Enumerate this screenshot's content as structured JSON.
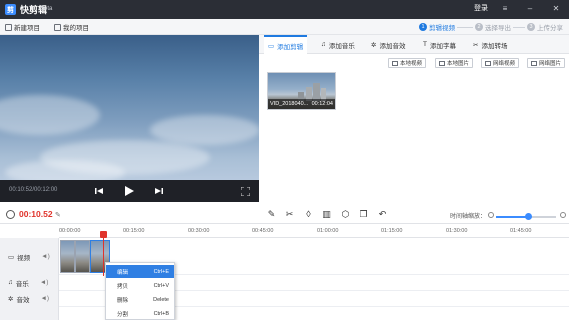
{
  "app": {
    "title": "快剪辑",
    "badge": "Beta"
  },
  "titlebar": {
    "login": "登录"
  },
  "toolbar": {
    "new_project": "新建项目",
    "my_projects": "我的项目"
  },
  "steps": [
    {
      "num": "1",
      "label": "剪辑视频"
    },
    {
      "num": "2",
      "label": "选择导出"
    },
    {
      "num": "3",
      "label": "上传分享"
    }
  ],
  "player": {
    "timecode": "00:10:52/00:12:00"
  },
  "right_tabs": [
    "添加剪辑",
    "添加音乐",
    "添加音效",
    "添加字幕",
    "添加转场"
  ],
  "source_buttons": [
    "本地视频",
    "本地图片",
    "网络视频",
    "网络图片"
  ],
  "media": {
    "name": "VID_2018040...",
    "duration": "00:12:04"
  },
  "edit": {
    "current_time": "00:10.52",
    "zoom_label": "时间轴缩放：",
    "zoom_level": 0.5
  },
  "ruler": [
    "00:00:00",
    "00:15:00",
    "00:30:00",
    "00:45:00",
    "01:00:00",
    "01:15:00",
    "01:30:00",
    "01:45:00"
  ],
  "tracks": [
    {
      "label": "视频"
    },
    {
      "label": "音乐"
    },
    {
      "label": "音效"
    }
  ],
  "context_menu": [
    {
      "label": "编辑",
      "shortcut": "Ctrl+E"
    },
    {
      "label": "拷贝",
      "shortcut": "Ctrl+V"
    },
    {
      "label": "删除",
      "shortcut": "Delete"
    },
    {
      "label": "分割",
      "shortcut": "Ctrl+B"
    }
  ],
  "colors": {
    "accent": "#1f7ae0",
    "playhead": "#e0332b",
    "titlebar": "#2b2e36"
  }
}
